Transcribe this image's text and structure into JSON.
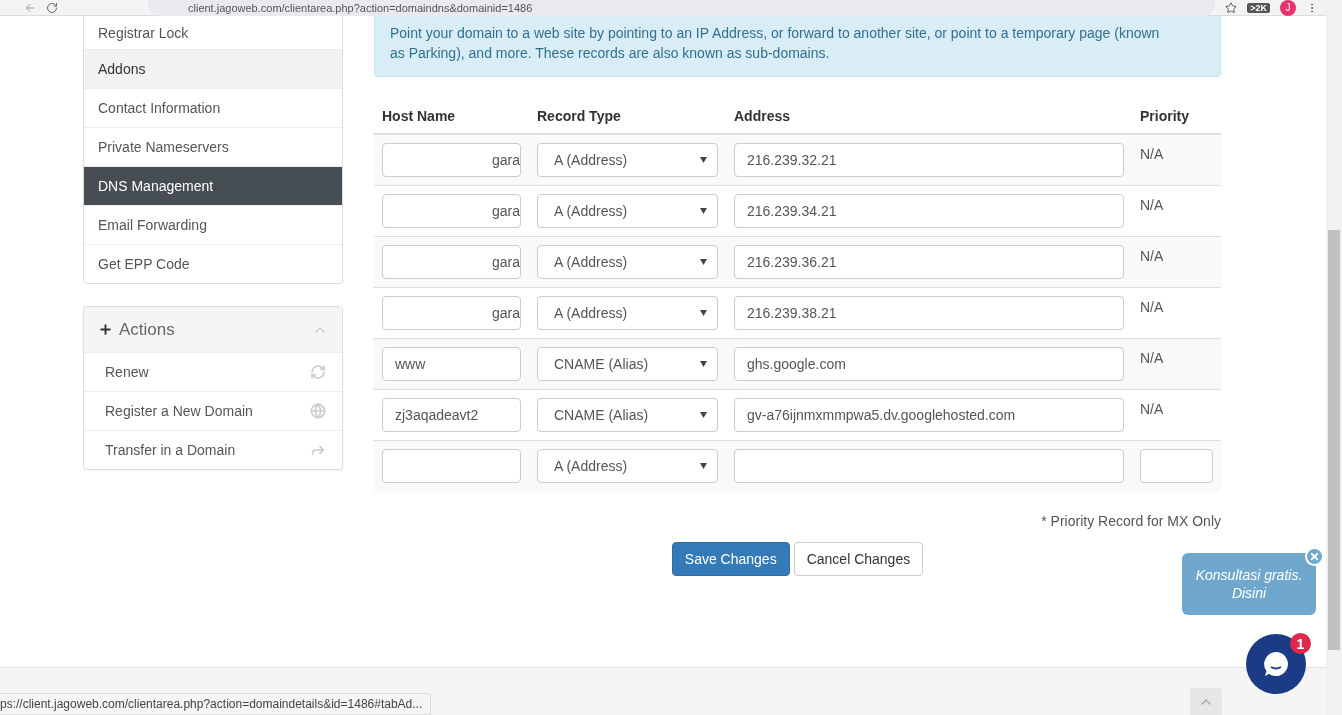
{
  "browser": {
    "url": "client.jagoweb.com/clientarea.php?action=domaindns&domainid=1486",
    "extension_badge": ">2K",
    "profile_initial": "J"
  },
  "sidebar": {
    "items": [
      {
        "label": "Registrar Lock",
        "selected": false,
        "hovered": false
      },
      {
        "label": "Addons",
        "selected": false,
        "hovered": true
      },
      {
        "label": "Contact Information",
        "selected": false,
        "hovered": false
      },
      {
        "label": "Private Nameservers",
        "selected": false,
        "hovered": false
      },
      {
        "label": "DNS Management",
        "selected": true,
        "hovered": false
      },
      {
        "label": "Email Forwarding",
        "selected": false,
        "hovered": false
      },
      {
        "label": "Get EPP Code",
        "selected": false,
        "hovered": false
      }
    ],
    "actions": {
      "title": "Actions",
      "expanded": true,
      "items": [
        {
          "label": "Renew",
          "kind": "refresh"
        },
        {
          "label": "Register a New Domain",
          "kind": "globe"
        },
        {
          "label": "Transfer in a Domain",
          "kind": "share"
        }
      ]
    }
  },
  "info": "Point your domain to a web site by pointing to an IP Address, or forward to another site, or point to a temporary page (known as Parking), and more. These records are also known as sub-domains.",
  "table": {
    "columns": [
      "Host Name",
      "Record Type",
      "Address",
      "Priority"
    ],
    "rows": [
      {
        "kind": "record",
        "host": "gara",
        "host_scrolled": true,
        "type": "A (Address)",
        "address": "216.239.32.21",
        "priority": "N/A"
      },
      {
        "kind": "record",
        "host": "gara",
        "host_scrolled": true,
        "type": "A (Address)",
        "address": "216.239.34.21",
        "priority": "N/A"
      },
      {
        "kind": "record",
        "host": "gara",
        "host_scrolled": true,
        "type": "A (Address)",
        "address": "216.239.36.21",
        "priority": "N/A"
      },
      {
        "kind": "record",
        "host": "gara",
        "host_scrolled": true,
        "type": "A (Address)",
        "address": "216.239.38.21",
        "priority": "N/A"
      },
      {
        "kind": "record",
        "host": "www",
        "host_scrolled": false,
        "type": "CNAME (Alias)",
        "address": "ghs.google.com",
        "priority": "N/A"
      },
      {
        "kind": "record",
        "host": "zj3aqadeavt2",
        "host_scrolled": false,
        "type": "CNAME (Alias)",
        "address": "gv-a76ijnmxmmpwa5.dv.googlehosted.com",
        "priority": "N/A"
      },
      {
        "kind": "new",
        "type": "A (Address)"
      }
    ]
  },
  "note": "* Priority Record for MX Only",
  "buttons": [
    {
      "label": "Save Changes",
      "kind": "primary"
    },
    {
      "label": "Cancel Changes",
      "kind": "default"
    }
  ],
  "chat": {
    "bubble_lines": [
      "Konsultasi gratis.",
      "Disini"
    ],
    "badge": "1"
  },
  "status_url": "ps://client.jagoweb.com/clientarea.php?action=domaindetails&id=1486#tabAd..."
}
